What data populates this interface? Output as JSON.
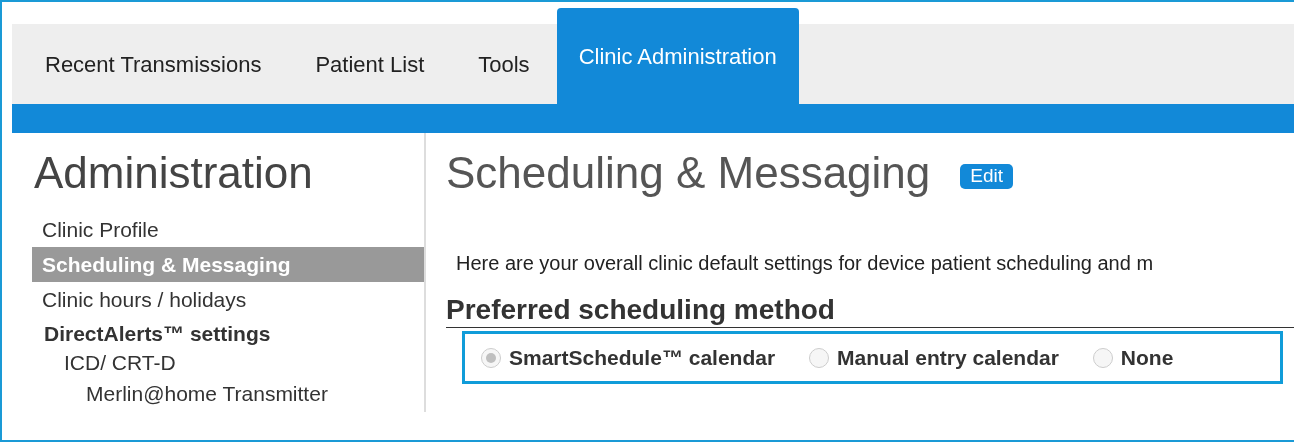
{
  "tabs": [
    {
      "label": "Recent Transmissions",
      "selected": false
    },
    {
      "label": "Patient List",
      "selected": false
    },
    {
      "label": "Tools",
      "selected": false
    },
    {
      "label": "Clinic Administration",
      "selected": true
    }
  ],
  "sidebar": {
    "title": "Administration",
    "items": [
      {
        "label": "Clinic Profile",
        "kind": "link",
        "selected": false
      },
      {
        "label": "Scheduling & Messaging",
        "kind": "link",
        "selected": true
      },
      {
        "label": "Clinic hours / holidays",
        "kind": "link",
        "selected": false
      },
      {
        "label": "DirectAlerts™ settings",
        "kind": "group",
        "selected": false,
        "children": [
          {
            "label": "ICD/ CRT-D",
            "kind": "link",
            "selected": false,
            "children": [
              {
                "label": "Merlin@home Transmitter",
                "kind": "link",
                "selected": false
              }
            ]
          }
        ]
      }
    ]
  },
  "main": {
    "title": "Scheduling & Messaging",
    "edit_button": "Edit",
    "intro": "Here are your overall clinic default settings for device patient scheduling and m",
    "section_title": "Preferred scheduling method",
    "options": [
      {
        "label": "SmartSchedule™ calendar",
        "selected": true,
        "disabled": true
      },
      {
        "label": "Manual entry calendar",
        "selected": false,
        "disabled": true
      },
      {
        "label": "None",
        "selected": false,
        "disabled": true
      }
    ]
  }
}
